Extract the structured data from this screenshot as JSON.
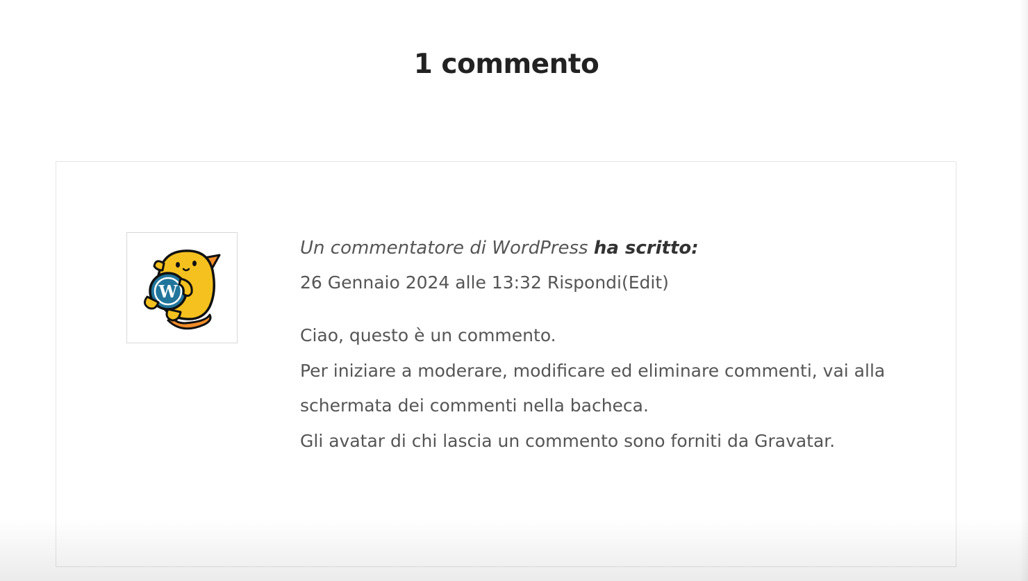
{
  "comments": {
    "title": "1 commento"
  },
  "comment": {
    "avatar_icon": "wapuu-wordpress-mascot-icon",
    "author": "Un commentatore di WordPress",
    "says": "ha scritto:",
    "date": "26 Gennaio 2024 alle 13:32",
    "reply_label": "Rispondi",
    "edit_label": "(Edit)",
    "content": {
      "line1": "Ciao, questo è un commento.",
      "line2": "Per iniziare a moderare, modificare ed eliminare commenti, vai alla schermata dei commenti nella bacheca.",
      "line3": "Gli avatar di chi lascia un commento sono forniti da Gravatar."
    }
  },
  "colors": {
    "text": "#555555",
    "title": "#222222",
    "border": "#e5e5e5",
    "wapuu_yellow": "#f5c11e",
    "wapuu_orange": "#f28c28",
    "wordpress_blue": "#21759b"
  }
}
